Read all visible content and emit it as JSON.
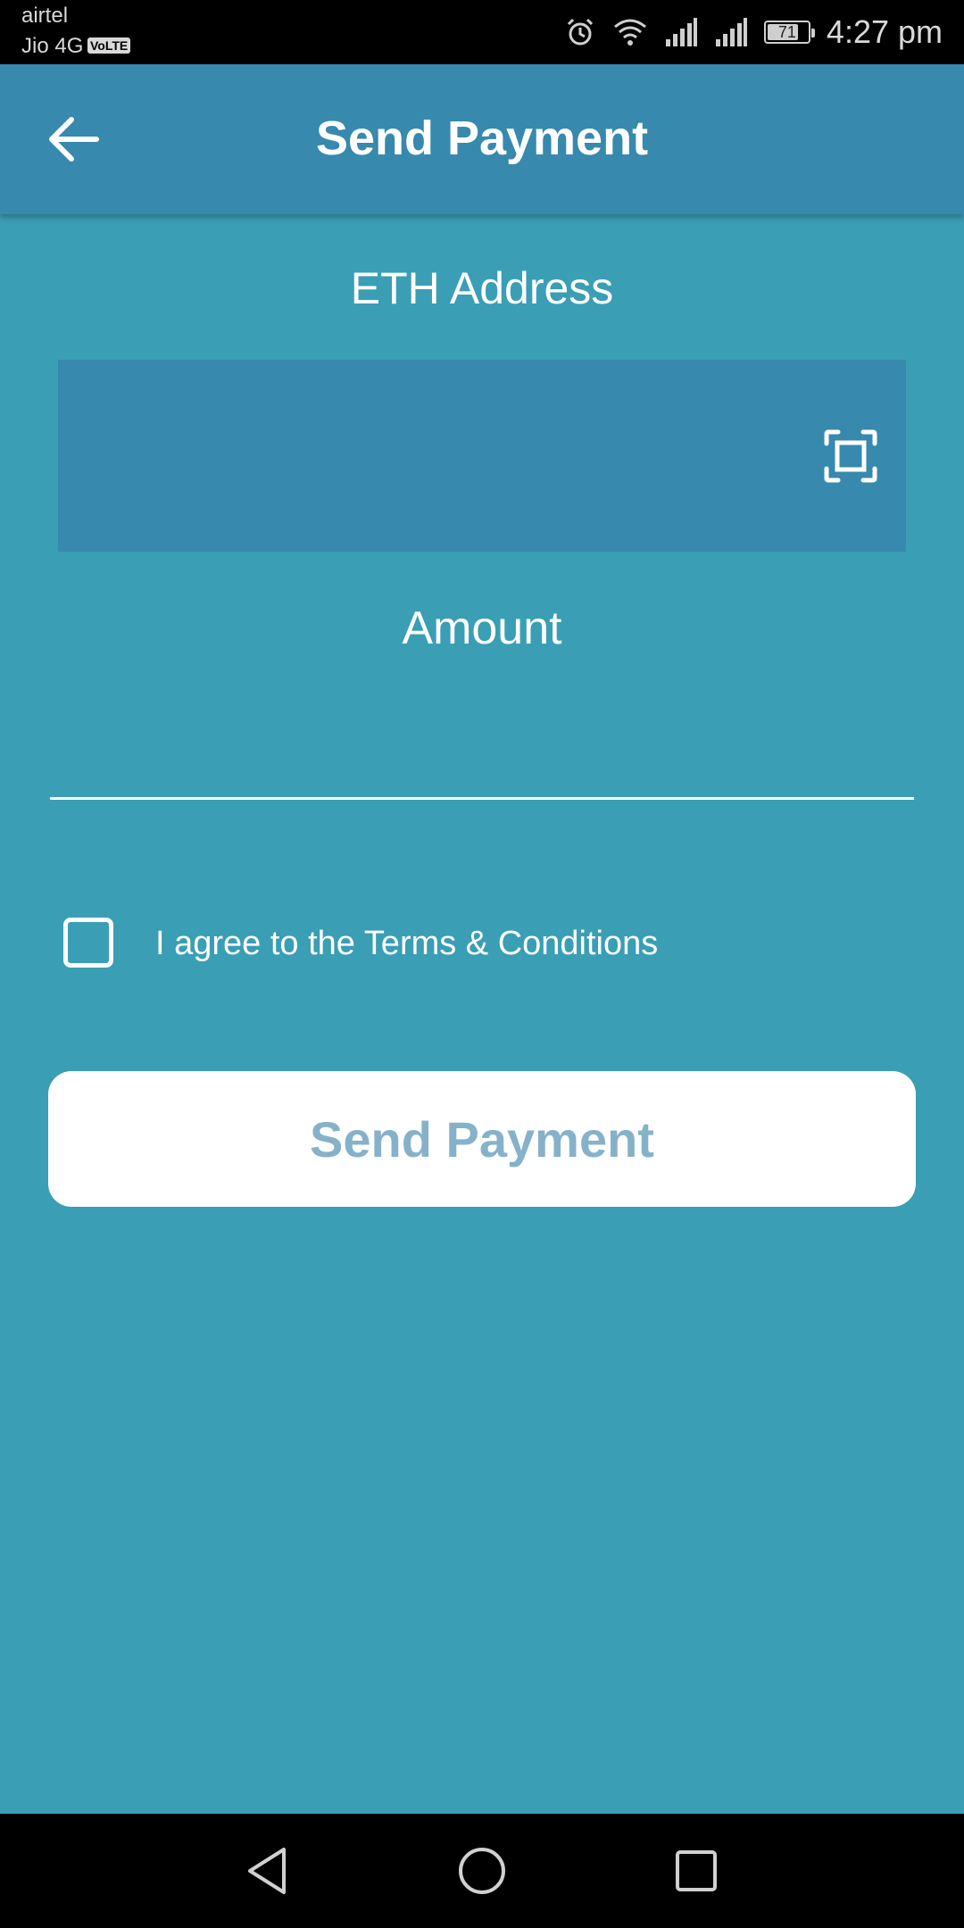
{
  "status_bar": {
    "carrier_1": "airtel",
    "carrier_2": "Jio 4G",
    "volte_badge": "VoLTE",
    "battery_level": "71",
    "time": "4:27 pm",
    "icons": [
      "alarm-icon",
      "wifi-icon",
      "signal-icon",
      "signal-icon",
      "battery-icon"
    ]
  },
  "app_bar": {
    "title": "Send Payment",
    "back_icon": "arrow-left-icon"
  },
  "form": {
    "eth_address_label": "ETH Address",
    "eth_address_value": "",
    "scan_icon": "qr-scan-icon",
    "amount_label": "Amount",
    "amount_value": "",
    "terms_checked": false,
    "terms_label": "I agree to the Terms & Conditions",
    "submit_label": "Send Payment"
  },
  "nav_bar": {
    "icons": [
      "back-triangle-icon",
      "home-circle-icon",
      "recents-square-icon"
    ]
  },
  "colors": {
    "background": "#3a9eb5",
    "app_bar": "#3789ad",
    "field": "#3789ad",
    "button_text": "#86b2c9"
  }
}
